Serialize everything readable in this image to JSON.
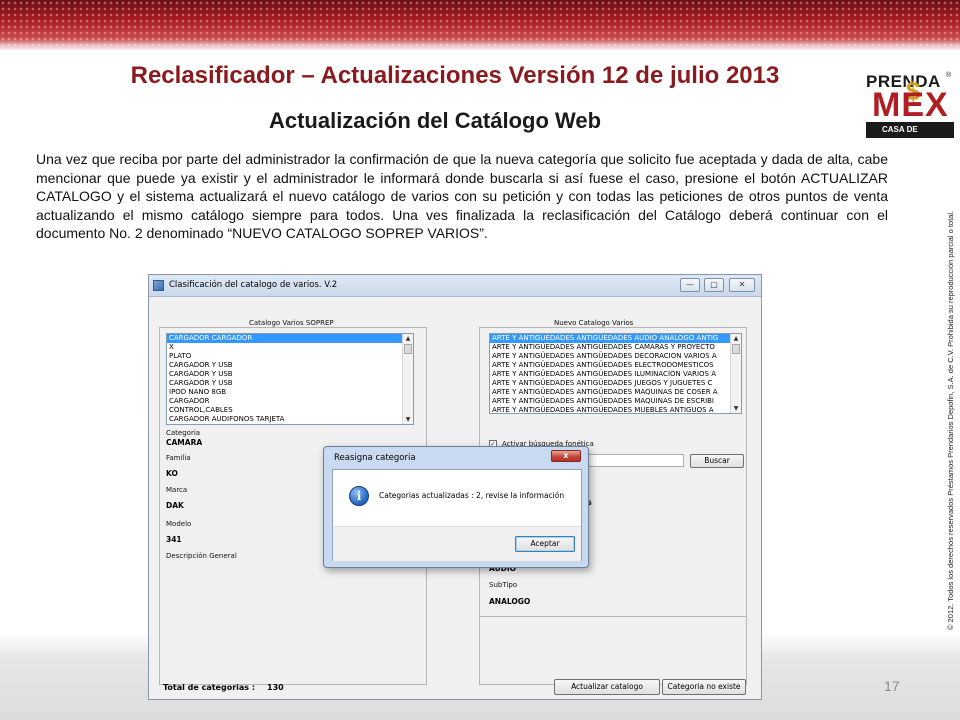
{
  "slide": {
    "title": "Reclasificador – Actualizaciones Versión 12 de julio 2013",
    "subtitle": "Actualización del Catálogo Web",
    "body": "Una vez que reciba por parte del administrador la confirmación de que la nueva categoría que solicito fue aceptada y dada de alta, cabe mencionar que puede ya existir y el administrador le informará donde buscarla si así fuese el caso, presione el botón ACTUALIZAR CATALOGO y el sistema actualizará el nuevo catálogo de varios con su petición y con todas las peticiones de otros puntos de venta actualizando el mismo catálogo siempre para todos. Una ves finalizada la reclasificación del Catálogo deberá continuar con el documento No. 2 denominado “NUEVO CATALOGO SOPREP VARIOS”.",
    "page_number": "17",
    "copyright": "© 2012. Todos los derechos reservados Préstamos Prendarios Depofin, S.A. de C.V. Prohibida su reproducción parcial o total.",
    "accent_color": "#8b1a1e"
  },
  "logo": {
    "line1": "PRENDA",
    "line2": "MEX",
    "dollar": "$",
    "registered": "®",
    "tagline": "CASA DE EMPEÑO"
  },
  "window": {
    "title": "Clasificación del catalogo de varios. V.2",
    "left_panel": {
      "header": "Catalogo Varios SOPREP",
      "items": [
        "CARGADOR CARGADOR",
        "X",
        "PLATO",
        "CARGADOR Y USB",
        "CARGADOR Y USB",
        "CARGADOR Y USB",
        "IPOD NANO 8GB",
        "CARGADOR",
        "CONTROL,CABLES",
        "CARGADOR AUDIFONOS TARJETA"
      ],
      "selected_index": 0,
      "categoria_label": "Categoria",
      "categoria_value": "CAMARA",
      "familia_label": "Familia",
      "familia_value": "KO",
      "marca_label": "Marca",
      "marca_value": "DAK",
      "modelo_label": "Modelo",
      "modelo_value": "341",
      "descripcion_label": "Descripción General"
    },
    "right_panel": {
      "header": "Nuevo Catalogo Varios",
      "items": [
        "ARTE Y ANTIGUEDADES ANTIGÜEDADES AUDIO ANALOGO ANTIG",
        "ARTE Y ANTIGÜEDADES ANTIGÜEDADES CAMARAS Y PROYECTO",
        "ARTE Y ANTIGÜEDADES ANTIGÜEDADES DECORACION VARIOS A",
        "ARTE Y ANTIGÜEDADES ANTIGÜEDADES ELECTRODOMESTICOS",
        "ARTE Y ANTIGÜEDADES ANTIGÜEDADES ILUMINACION VARIOS A",
        "ARTE Y ANTIGÜEDADES ANTIGÜEDADES JUEGOS Y JUGUETES C",
        "ARTE Y ANTIGÜEDADES ANTIGÜEDADES MAQUINAS DE COSER A",
        "ARTE Y ANTIGÜEDADES ANTIGÜEDADES MAQUINAS DE ESCRIBI",
        "ARTE Y ANTIGÜEDADES ANTIGÜEDADES MUEBLES ANTIGUOS A"
      ],
      "selected_index": 0,
      "phonetic_label": "Activar búsqueda fonética",
      "phonetic_checked": true,
      "search_value": "",
      "search_button": "Buscar",
      "partial_label": "s",
      "tipo_value": "AUDIO",
      "subtipo_label": "SubTipo",
      "subtipo_value": "ANALOGO"
    },
    "footer": {
      "total_label": "Total de categorias :",
      "total_value": "130",
      "update_button": "Actualizar catalogo",
      "not_exists_button": "Categoria no existe"
    },
    "controls": {
      "minimize": "—",
      "maximize": "▢",
      "close": "✕"
    }
  },
  "dialog": {
    "title": "Reasigna categoria",
    "close": "x",
    "message": "Categorias actualizadas : 2, revise la información",
    "icon": "info-icon",
    "ok_button": "Aceptar"
  }
}
